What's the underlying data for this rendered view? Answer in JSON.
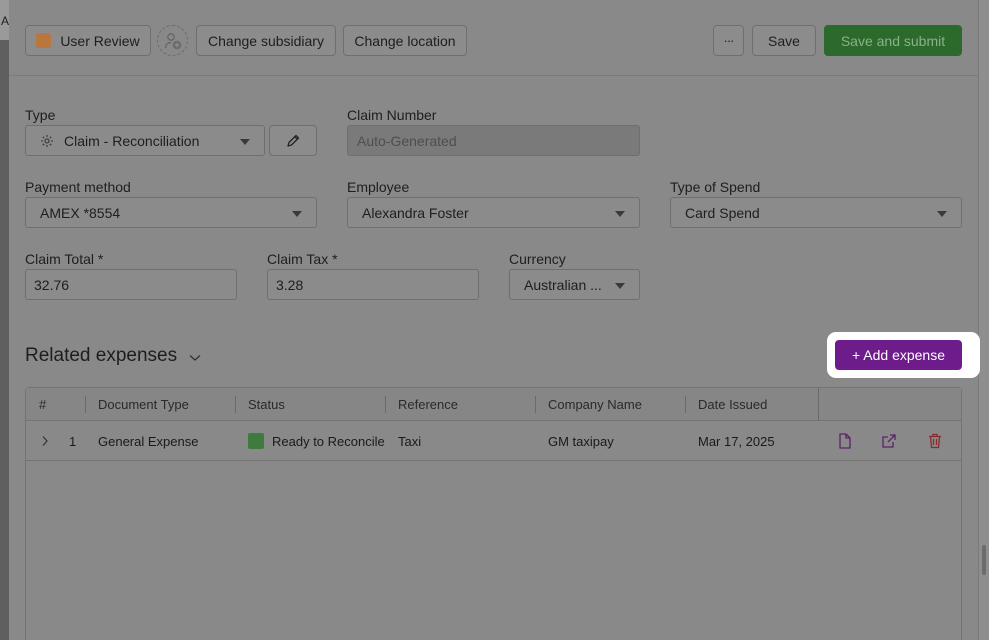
{
  "background": {
    "partial_text": "A"
  },
  "header": {
    "status_label": "User Review",
    "status_color": "#b9773d",
    "change_subsidiary": "Change subsidiary",
    "change_location": "Change location",
    "more_label": "···",
    "save_label": "Save",
    "save_submit_label": "Save and submit",
    "save_submit_color": "#2b6a2a"
  },
  "form": {
    "type": {
      "label": "Type",
      "value": "Claim - Reconciliation"
    },
    "claim_number": {
      "label": "Claim Number",
      "value": "Auto-Generated"
    },
    "payment_method": {
      "label": "Payment method",
      "value": "AMEX *8554"
    },
    "employee": {
      "label": "Employee",
      "value": "Alexandra Foster"
    },
    "type_of_spend": {
      "label": "Type of Spend",
      "value": "Card Spend"
    },
    "claim_total": {
      "label": "Claim Total *",
      "value": "32.76"
    },
    "claim_tax": {
      "label": "Claim Tax *",
      "value": "3.28"
    },
    "currency": {
      "label": "Currency",
      "value": "Australian ..."
    }
  },
  "related": {
    "title": "Related expenses",
    "add_label": "+ Add expense",
    "add_color": "#6e1b8b"
  },
  "table": {
    "columns": [
      "#",
      "Document Type",
      "Status",
      "Reference",
      "Company Name",
      "Date Issued"
    ],
    "rows": [
      {
        "num": "1",
        "document_type": "General Expense",
        "status": "Ready to Reconcile",
        "status_color": "#3d7c3d",
        "reference": "Taxi",
        "company_name": "GM taxipay",
        "date_issued": "Mar 17, 2025"
      }
    ]
  }
}
